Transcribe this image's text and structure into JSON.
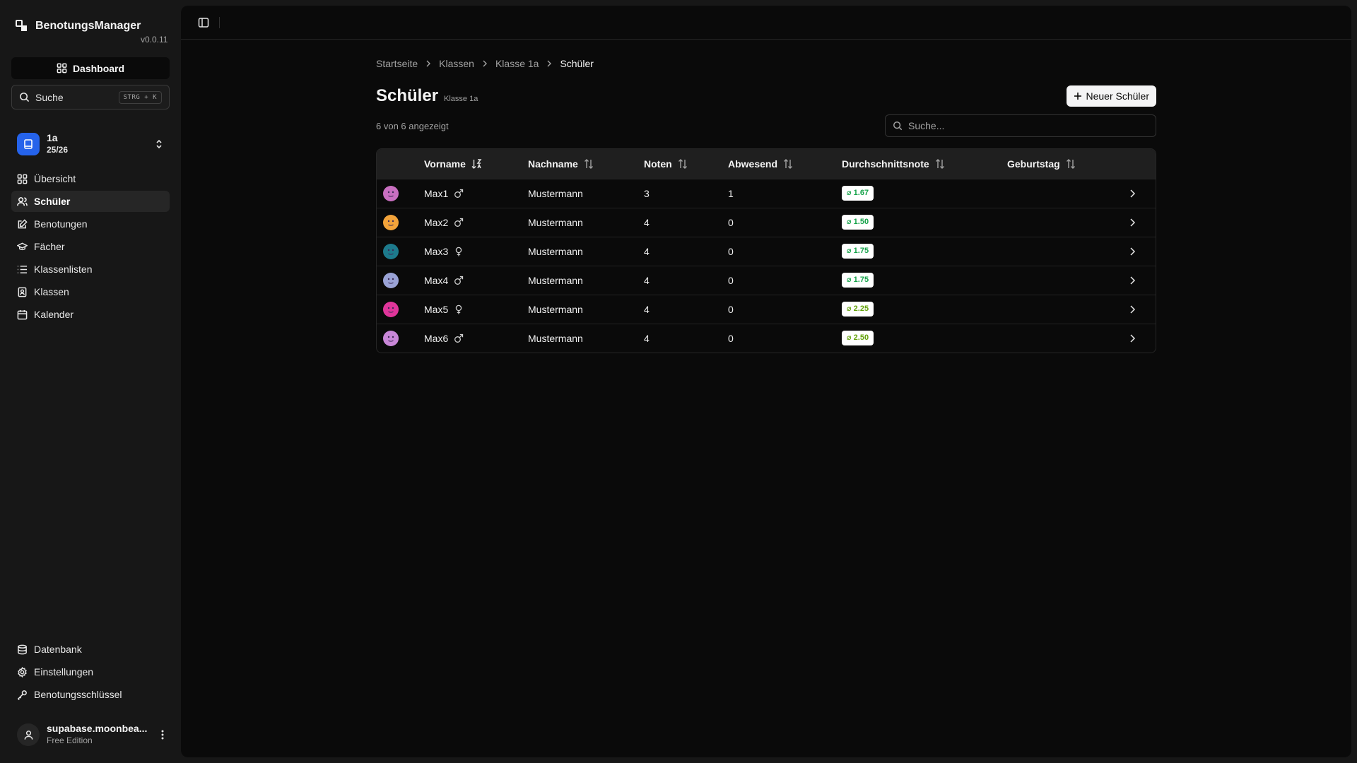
{
  "app": {
    "name": "BenotungsManager",
    "version": "v0.0.11"
  },
  "sidebar": {
    "dashboard_label": "Dashboard",
    "search_label": "Suche",
    "search_shortcut": "STRG + K",
    "class_switch": {
      "name": "1a",
      "sub": "25/26"
    },
    "nav": [
      {
        "label": "Übersicht",
        "icon": "grid-icon"
      },
      {
        "label": "Schüler",
        "icon": "users-icon",
        "active": true
      },
      {
        "label": "Benotungen",
        "icon": "edit-icon"
      },
      {
        "label": "Fächer",
        "icon": "graduation-cap-icon"
      },
      {
        "label": "Klassenlisten",
        "icon": "list-icon"
      },
      {
        "label": "Klassen",
        "icon": "contact-book-icon"
      },
      {
        "label": "Kalender",
        "icon": "calendar-icon"
      }
    ],
    "bottom_nav": [
      {
        "label": "Datenbank",
        "icon": "database-icon"
      },
      {
        "label": "Einstellungen",
        "icon": "gear-icon"
      },
      {
        "label": "Benotungsschlüssel",
        "icon": "key-icon"
      }
    ],
    "user": {
      "name": "supabase.moonbea...",
      "plan": "Free Edition"
    }
  },
  "breadcrumb": [
    "Startseite",
    "Klassen",
    "Klasse 1a",
    "Schüler"
  ],
  "page": {
    "title": "Schüler",
    "subtitle": "Klasse 1a",
    "new_button": "Neuer Schüler",
    "count_text": "6 von 6 angezeigt",
    "search_placeholder": "Suche..."
  },
  "table": {
    "columns": [
      "Vorname",
      "Nachname",
      "Noten",
      "Abwesend",
      "Durchschnittsnote",
      "Geburtstag"
    ],
    "rows": [
      {
        "vorname": "Max1",
        "gender": "male",
        "nachname": "Mustermann",
        "noten": "3",
        "abwesend": "1",
        "schnitt": "⌀ 1.67",
        "avatar": "#c86fc0",
        "badge_color": "#16a34a",
        "geburtstag": ""
      },
      {
        "vorname": "Max2",
        "gender": "male",
        "nachname": "Mustermann",
        "noten": "4",
        "abwesend": "0",
        "schnitt": "⌀ 1.50",
        "avatar": "#f2a33a",
        "badge_color": "#16a34a",
        "geburtstag": ""
      },
      {
        "vorname": "Max3",
        "gender": "female",
        "nachname": "Mustermann",
        "noten": "4",
        "abwesend": "0",
        "schnitt": "⌀ 1.75",
        "avatar": "#1d7a8c",
        "badge_color": "#16a34a",
        "geburtstag": ""
      },
      {
        "vorname": "Max4",
        "gender": "male",
        "nachname": "Mustermann",
        "noten": "4",
        "abwesend": "0",
        "schnitt": "⌀ 1.75",
        "avatar": "#9aa3d6",
        "badge_color": "#16a34a",
        "geburtstag": ""
      },
      {
        "vorname": "Max5",
        "gender": "female",
        "nachname": "Mustermann",
        "noten": "4",
        "abwesend": "0",
        "schnitt": "⌀ 2.25",
        "avatar": "#e0359a",
        "badge_color": "#65a30d",
        "geburtstag": ""
      },
      {
        "vorname": "Max6",
        "gender": "male",
        "nachname": "Mustermann",
        "noten": "4",
        "abwesend": "0",
        "schnitt": "⌀ 2.50",
        "avatar": "#c987d8",
        "badge_color": "#65a30d",
        "geburtstag": ""
      }
    ]
  }
}
